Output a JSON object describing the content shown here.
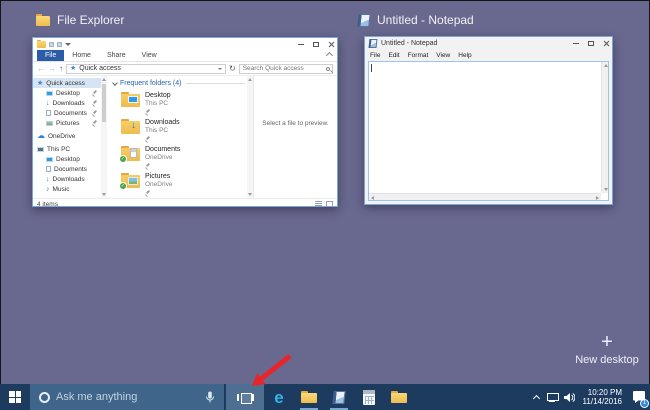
{
  "desktop": {
    "new_desktop_label": "New desktop"
  },
  "thumbnails": {
    "file_explorer": {
      "label": "File Explorer",
      "win": {
        "tabs": [
          {
            "label": "File"
          },
          {
            "label": "Home"
          },
          {
            "label": "Share"
          },
          {
            "label": "View"
          }
        ],
        "address": "Quick access",
        "search_placeholder": "Search Quick access",
        "sidebar": [
          {
            "label": "Quick access"
          },
          {
            "label": "Desktop"
          },
          {
            "label": "Downloads"
          },
          {
            "label": "Documents"
          },
          {
            "label": "Pictures"
          },
          {
            "label": "OneDrive"
          },
          {
            "label": "This PC"
          },
          {
            "label": "Desktop"
          },
          {
            "label": "Documents"
          },
          {
            "label": "Downloads"
          },
          {
            "label": "Music"
          }
        ],
        "group_header": "Frequent folders (4)",
        "folders": [
          {
            "name": "Desktop",
            "location": "This PC"
          },
          {
            "name": "Downloads",
            "location": "This PC"
          },
          {
            "name": "Documents",
            "location": "OneDrive"
          },
          {
            "name": "Pictures",
            "location": "OneDrive"
          }
        ],
        "preview_text": "Select a file to preview.",
        "status_text": "4 items"
      }
    },
    "notepad": {
      "label": "Untitled - Notepad",
      "win": {
        "title": "Untitled - Notepad",
        "menus": [
          {
            "label": "File"
          },
          {
            "label": "Edit"
          },
          {
            "label": "Format"
          },
          {
            "label": "View"
          },
          {
            "label": "Help"
          }
        ]
      }
    }
  },
  "taskbar": {
    "search_placeholder": "Ask me anything",
    "clock": {
      "time": "10:20 PM",
      "date": "11/14/2016"
    },
    "notification_badge": "1"
  },
  "glyphs": {
    "back": "←",
    "forward": "→",
    "up": "↑",
    "refresh": "↻",
    "star": "★",
    "cloud": "☁",
    "down_arrow": "↓",
    "music": "♪",
    "check1": "✓",
    "check2": "✓",
    "edge": "e",
    "plus": "+"
  },
  "colors": {
    "desktop_background": "#69688f",
    "taskbar": "#1c3b5e",
    "taskview_active": "#4e6f92",
    "file_tab_blue": "#2a5ca8",
    "annotation_arrow": "#e8252a"
  }
}
